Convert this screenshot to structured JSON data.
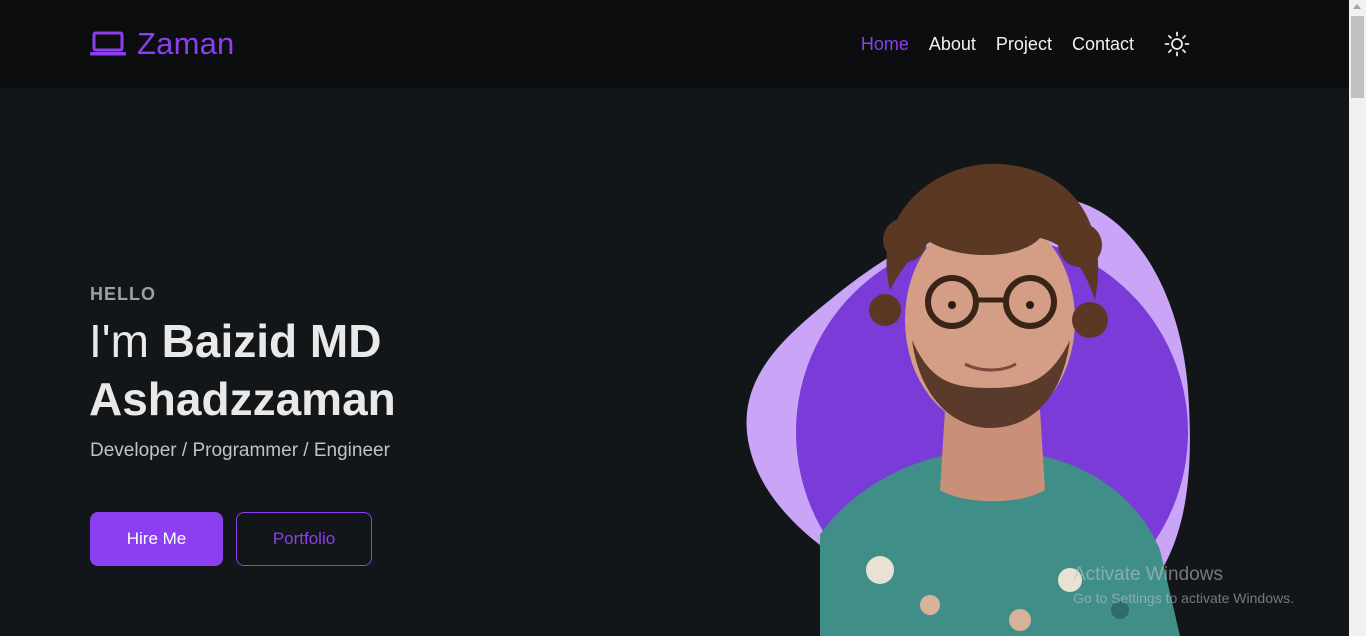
{
  "brand": {
    "name": "Zaman",
    "icon": "laptop-icon",
    "accent": "#8b3ff0"
  },
  "nav": {
    "items": [
      {
        "label": "Home",
        "active": true
      },
      {
        "label": "About",
        "active": false
      },
      {
        "label": "Project",
        "active": false
      },
      {
        "label": "Contact",
        "active": false
      }
    ],
    "theme_toggle_icon": "sun-icon"
  },
  "hero": {
    "greeting": "HELLO",
    "intro": "I'm",
    "name": "Baizid MD Ashadzzaman",
    "roles": "Developer / Programmer / Engineer",
    "primary_button": "Hire Me",
    "secondary_button": "Portfolio"
  },
  "watermark": {
    "title": "Activate Windows",
    "subtitle": "Go to Settings to activate Windows."
  },
  "colors": {
    "background": "#131618",
    "header": "#0c0d0e",
    "accent": "#8b3ff0",
    "blob_light": "#c9a4f7",
    "blob_dark": "#7a3bd8"
  }
}
